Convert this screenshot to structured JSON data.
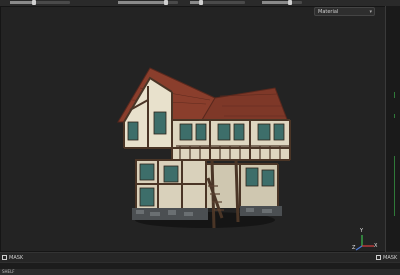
{
  "toolbar": {
    "sliders": [
      {
        "name": "slider-1",
        "value": 0.4
      },
      {
        "name": "slider-2",
        "value": 0.8
      },
      {
        "name": "slider-3",
        "value": 0.2
      },
      {
        "name": "slider-4",
        "value": 0.7
      }
    ]
  },
  "viewport": {
    "channel_dropdown": {
      "value": "Material"
    },
    "gizmo": {
      "x": "X",
      "y": "Y",
      "z": "Z"
    }
  },
  "mask_bar": {
    "left_label": "MASK",
    "right_label": "MASK"
  },
  "shelf": {
    "label": "SHELF"
  },
  "colors": {
    "background": "#1e1e1e",
    "viewport": "#232323",
    "roof": "#8a3e2c",
    "timber": "#4a3526",
    "plaster": "#e8e1cc",
    "window": "#3d6e6a",
    "axis_green": "#3cbf4f"
  },
  "icons": [
    "mask-icon",
    "chevron-down-icon",
    "axis-gizmo-icon",
    "house-model"
  ]
}
